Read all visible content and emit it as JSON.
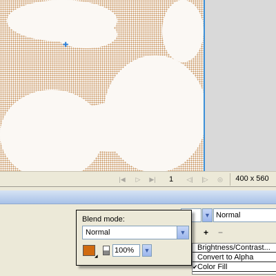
{
  "canvas": {
    "cursor_icon": "crosshair-icon"
  },
  "status_bar": {
    "frame_number": "1",
    "doc_size": "400 x 560",
    "controls": [
      "first-frame-icon",
      "play-icon",
      "last-frame-icon",
      "prev-frame-icon",
      "next-frame-icon",
      "loop-icon"
    ]
  },
  "effects_panel": {
    "blend_mode_value": "Normal",
    "add_icon": "plus-icon",
    "remove_icon": "minus-icon",
    "effects": [
      {
        "label": "Brightness/Contrast...",
        "checked": false
      },
      {
        "label": "Convert to Alpha",
        "checked": false
      },
      {
        "label": "Color Fill",
        "checked": true
      }
    ]
  },
  "blend_popup": {
    "label": "Blend mode:",
    "mode_value": "Normal",
    "color": "#d06a10",
    "opacity": "100%"
  }
}
